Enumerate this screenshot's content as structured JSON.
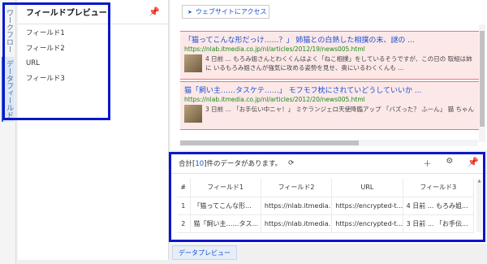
{
  "vertical_tabs": [
    {
      "label": "ワークフロー"
    },
    {
      "label": "データフィールド"
    }
  ],
  "field_panel": {
    "title": "フィールドプレビュー",
    "pin_icon": "pin-icon",
    "fields": [
      "フィールド1",
      "フィールド2",
      "URL",
      "フィールド3"
    ]
  },
  "web_preview": {
    "access_button": "ウェブサイトにアクセス",
    "results": [
      {
        "title": "「猫ってこんな形だっけ……？」 姉猫との白熱した相撲の末、謎の ...",
        "url": "https://nlab.itmedia.co.jp/nl/articles/2012/19/news005.html",
        "snippet_line1": "4 日前 ... もろみ姐さんとわくくんはよく「ねこ相撲」をしているそうですが、この日の 取組は姉",
        "snippet_line2": "に いるもろみ姐さんが強気に攻める姿勢を見せ、奥にいるわくくんも ..."
      },
      {
        "title": "猫「飼い主……タスケテ……」 モフモフ枕にされていどうしていいか ...",
        "url": "https://nlab.itmedia.co.jp/nl/articles/2012/20/news005.html",
        "snippet_line1": "3 日前 ... 「お手伝い中ニャ！」 ミケランジェロ天使降臨アップ 「バズった？ ふーん」 猫 ちゃん",
        "snippet_line2": ""
      }
    ]
  },
  "data_panel": {
    "count_prefix": "合計[",
    "count_value": "10",
    "count_suffix": "]件のデータがあります。",
    "columns": [
      "#",
      "フィールド1",
      "フィールド2",
      "URL",
      "フィールド3"
    ],
    "rows": [
      [
        "1",
        "「猫ってこんな形...",
        "https://nlab.itmedia...",
        "https://encrypted-t...",
        "4 日前 ... もろみ姐..."
      ],
      [
        "2",
        "猫「飼い主……タス...",
        "https://nlab.itmedia...",
        "https://encrypted-t...",
        "3 日前 ... 「お手伝..."
      ]
    ]
  },
  "bottom_tab": {
    "label": "データプレビュー"
  }
}
